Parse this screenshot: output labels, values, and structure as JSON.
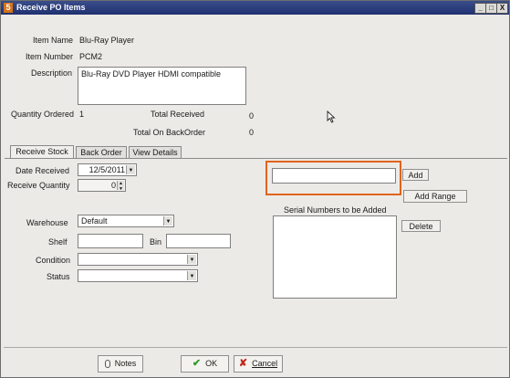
{
  "window": {
    "title": "Receive PO Items",
    "app_icon": "5",
    "min": "_",
    "max": "□",
    "close": "X"
  },
  "item": {
    "name_label": "Item Name",
    "name_value": "Blu-Ray Player",
    "number_label": "Item Number",
    "number_value": "PCM2",
    "description_label": "Description",
    "description_value": "Blu-Ray DVD Player HDMI compatible"
  },
  "quantities": {
    "ordered_label": "Quantity Ordered",
    "ordered_value": "1",
    "received_label": "Total Received",
    "received_value": "0",
    "backorder_label": "Total On BackOrder",
    "backorder_value": "0"
  },
  "tabs": [
    {
      "label": "Receive Stock",
      "active": true
    },
    {
      "label": "Back Order",
      "active": false
    },
    {
      "label": "View Details",
      "active": false
    }
  ],
  "receive": {
    "date_label": "Date Received",
    "date_value": "12/5/2011",
    "qty_label": "Receive Quantity",
    "qty_value": "0",
    "warehouse_label": "Warehouse",
    "warehouse_value": "Default",
    "shelf_label": "Shelf",
    "shelf_value": "",
    "bin_label": "Bin",
    "bin_value": "",
    "condition_label": "Condition",
    "condition_value": "",
    "status_label": "Status",
    "status_value": ""
  },
  "serials": {
    "input_value": "",
    "add_label": "Add",
    "add_range_label": "Add Range",
    "list_title": "Serial Numbers to be Added",
    "delete_label": "Delete",
    "highlight_color": "#e0641e"
  },
  "footer": {
    "notes_label": "Notes",
    "ok_label": "OK",
    "cancel_label": "Cancel"
  }
}
